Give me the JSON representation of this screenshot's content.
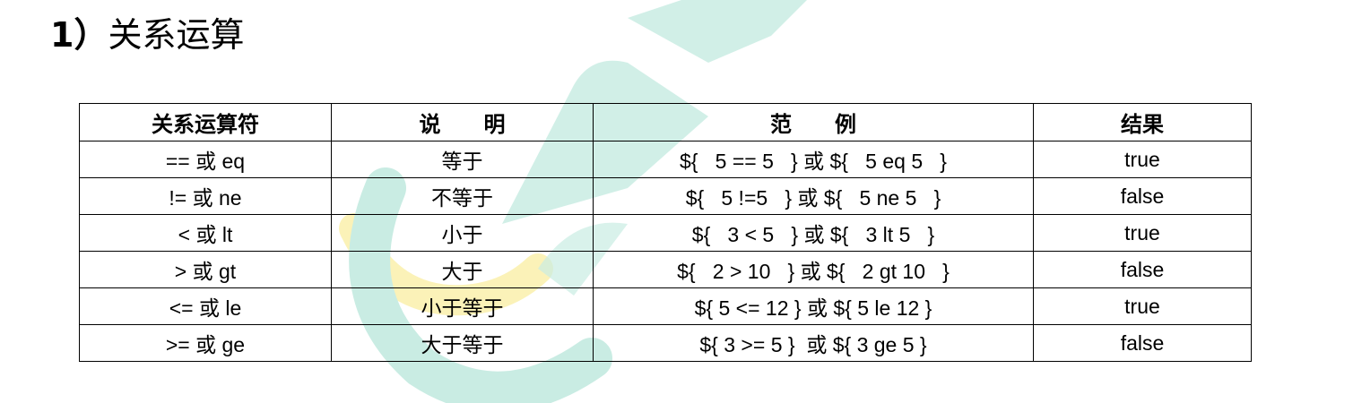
{
  "heading": {
    "number": "1）",
    "title": "关系运算"
  },
  "table": {
    "headers": [
      "关系运算符",
      "说　　明",
      "范　　例",
      "结果"
    ],
    "rows": [
      {
        "operator": "== 或 eq",
        "description": "等于",
        "example": "${   5 == 5   } 或 ${   5 eq 5   }",
        "result": "true"
      },
      {
        "operator": "!= 或 ne",
        "description": "不等于",
        "example": "${   5 !=5   } 或 ${   5 ne 5   }",
        "result": "false"
      },
      {
        "operator": "< 或 lt",
        "description": "小于",
        "example": "${   3 < 5   } 或 ${   3 lt 5   }",
        "result": "true"
      },
      {
        "operator": "> 或 gt",
        "description": "大于",
        "example": "${   2 > 10   } 或 ${   2 gt 10   }",
        "result": "false"
      },
      {
        "operator": "<= 或 le",
        "description": "小于等于",
        "example": "${ 5 <= 12 } 或 ${ 5 le 12 }",
        "result": "true"
      },
      {
        "operator": ">= 或 ge",
        "description": "大于等于",
        "example": "${ 3 >= 5 }  或 ${ 3 ge 5 }",
        "result": "false"
      }
    ]
  },
  "watermark": {
    "colors": {
      "teal": "#c9ece3",
      "yellow": "#fbf2b8"
    }
  }
}
